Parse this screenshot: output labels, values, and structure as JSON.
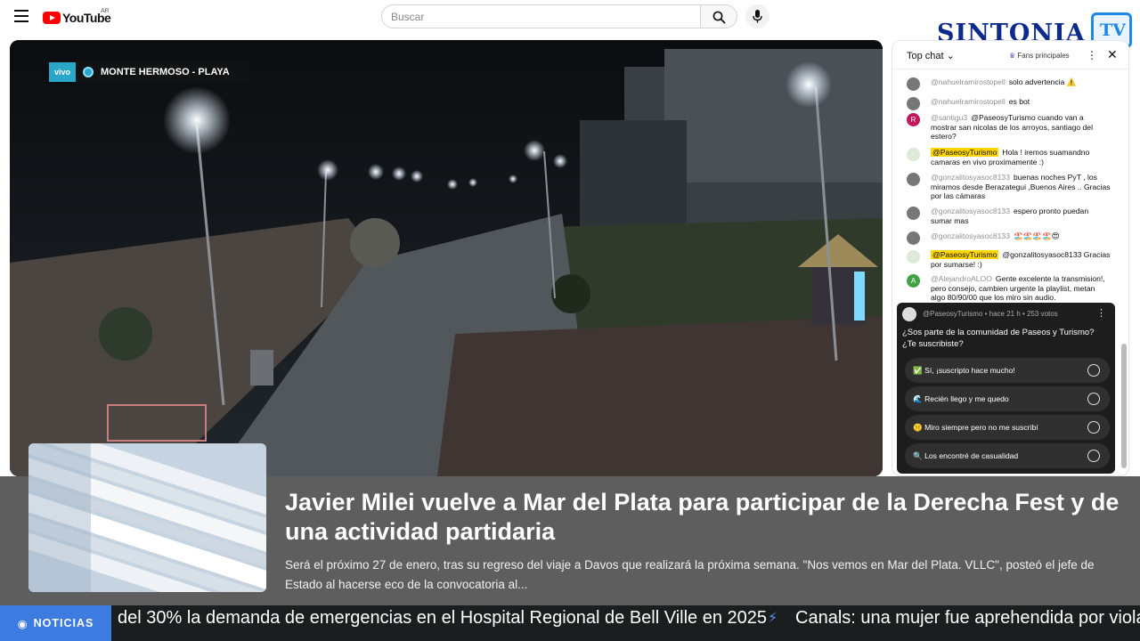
{
  "topbar": {
    "logo_text": "YouTube",
    "country_code": "AR",
    "search_placeholder": "Buscar",
    "menu_icon": "hamburger-icon",
    "search_icon": "search-icon",
    "mic_icon": "mic-icon"
  },
  "brand": {
    "name": "SINTONIA",
    "tv": "TV",
    "color": "#0d2a8c",
    "accent": "#1e88e5"
  },
  "video": {
    "live_badge": "vivo",
    "location": "MONTE HERMOSO - PLAYA"
  },
  "chat": {
    "mode_label": "Top chat",
    "fans_label": "Fans principales",
    "messages": [
      {
        "avatar": "",
        "author": "@nahuelramirostopell",
        "text": "solo advertencia ⚠️",
        "owner": false
      },
      {
        "avatar": "",
        "author": "@nahuelramirostopell",
        "text": "es bot",
        "owner": false
      },
      {
        "avatar": "R",
        "author": "@santigu3",
        "text": "@PaseosyTurismo cuando van a mostrar san nicolas de los arroyos, santiago del estero?",
        "owner": false
      },
      {
        "avatar": "",
        "author": "@PaseosyTurismo",
        "text": "Hola ! iremos suamandno camaras en vivo proximamente :)",
        "owner": true
      },
      {
        "avatar": "",
        "author": "@gonzalitosyasoc8133",
        "text": "buenas noches PyT , los miramos desde Berazategui ,Buenos Aires .. Gracias por las cámaras",
        "owner": false
      },
      {
        "avatar": "",
        "author": "@gonzalitosyasoc8133",
        "text": "espero pronto puedan sumar mas",
        "owner": false
      },
      {
        "avatar": "",
        "author": "@gonzalitosyasoc8133",
        "text": "🏖️🏖️🏖️🏖️😍",
        "owner": false
      },
      {
        "avatar": "",
        "author": "@PaseosyTurismo",
        "text": "@gonzalitosyasoc8133 Gracias por sumarse! :)",
        "owner": true
      },
      {
        "avatar": "A",
        "author": "@AlejandroALOO",
        "text": "Gente excelente la transmision!, pero consejo, cambien urgente la playlist, metan algo 80/90/00 que los miro sin audio.",
        "owner": false
      }
    ]
  },
  "poll": {
    "meta": "@PaseosyTurismo • hace 21 h • 253 votos",
    "question": "¿Sos parte de la comunidad de Paseos y Turismo? ¿Te suscribiste?",
    "options": [
      "✅ Sí, ¡suscripto hace mucho!",
      "🌊 Recién llego y me quedo",
      "🤫 Miro siempre pero no me suscribí",
      "🔍 Los encontré de casualidad"
    ]
  },
  "news": {
    "title": "Javier Milei vuelve a Mar del Plata para participar de la Derecha Fest y de una actividad partidaria",
    "description": "Será el próximo 27 de enero, tras su regreso del viaje a Davos que realizará la próxima semana. \"Nos vemos en Mar del Plata. VLLC\", posteó el jefe de Estado al hacerse eco de la convocatoria al..."
  },
  "ticker": {
    "tag": "NOTICIAS",
    "items": [
      "del 30% la demanda de emergencias en el Hospital Regional de Bell Ville en 2025",
      "Canals: una mujer fue aprehendida por violar"
    ]
  }
}
